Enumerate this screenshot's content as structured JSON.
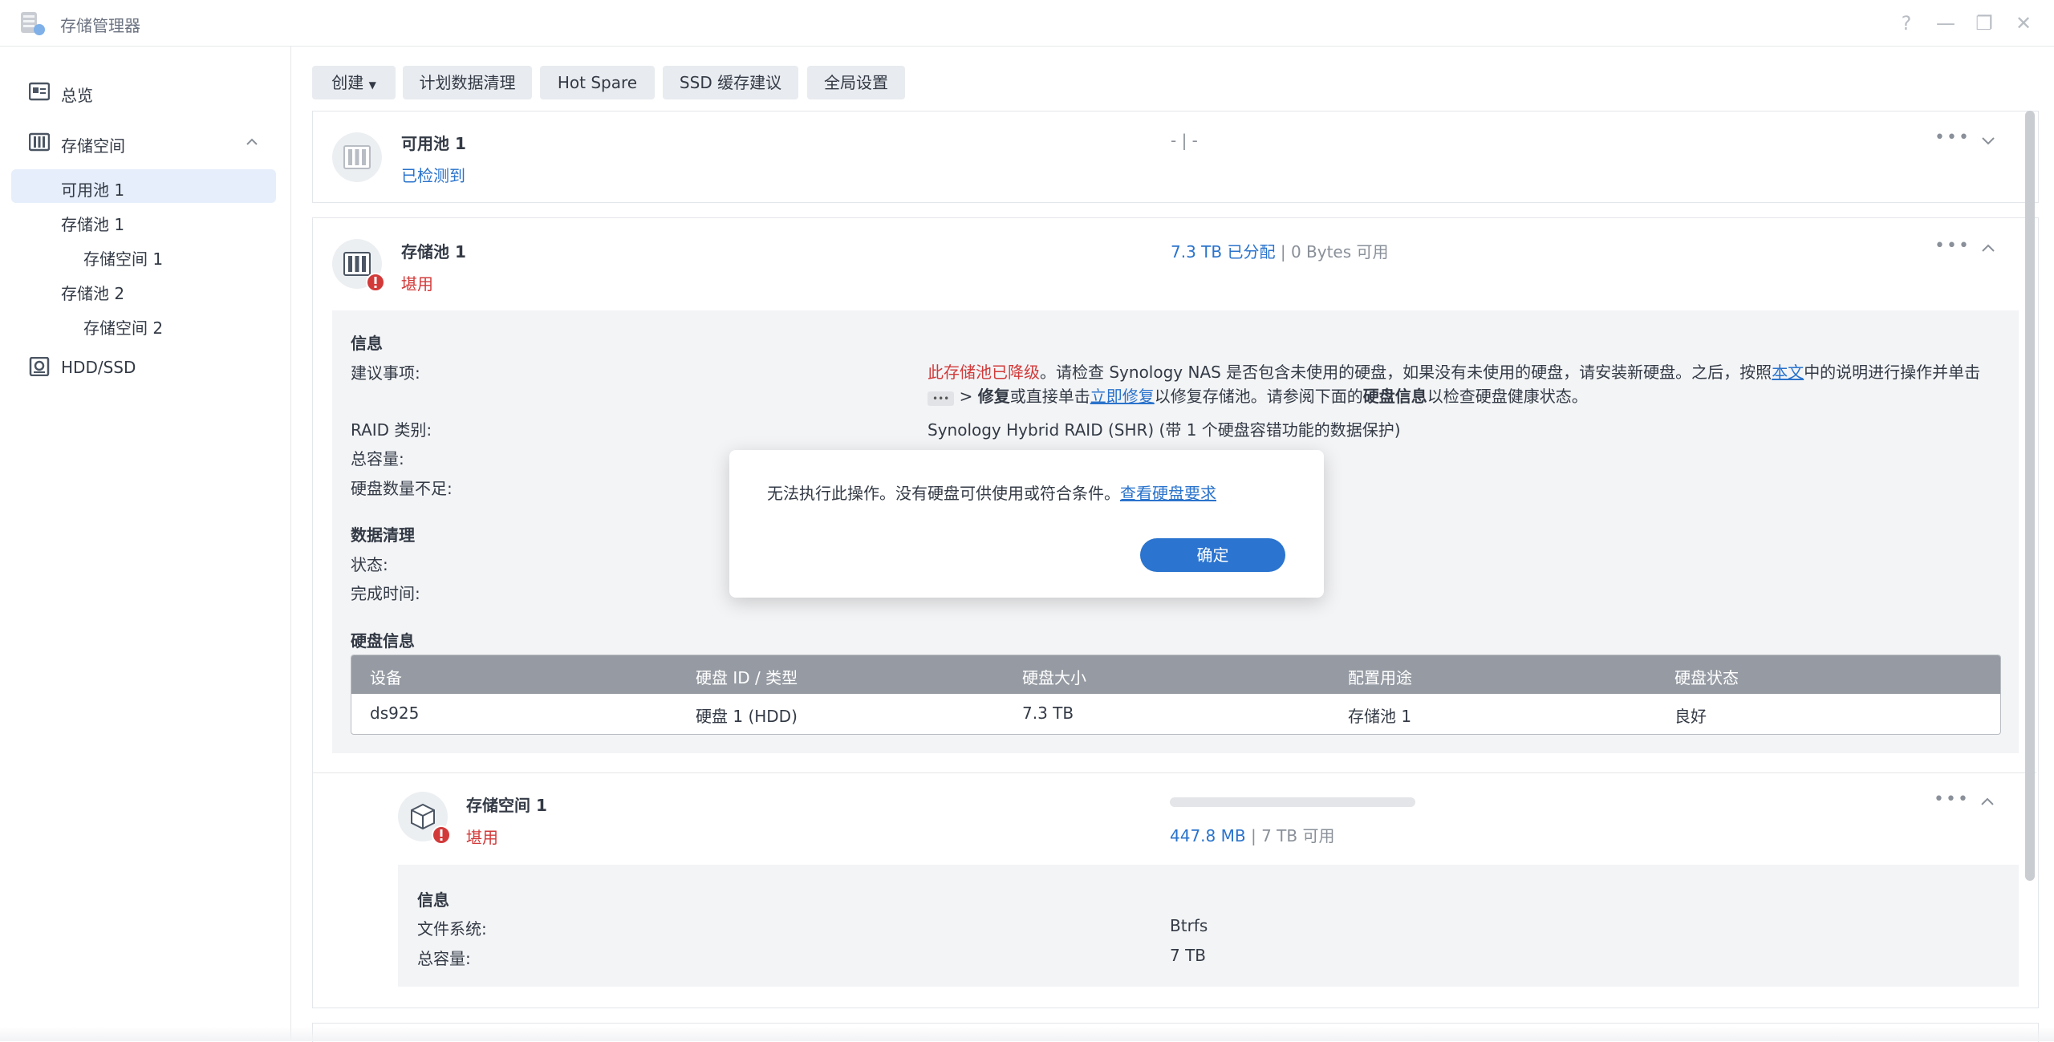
{
  "app": {
    "title": "存储管理器"
  },
  "window_controls": {
    "help": "?",
    "minimize": "—",
    "restore": "❐",
    "close": "✕"
  },
  "sidebar": {
    "items": [
      {
        "label": "总览",
        "icon": "overview-icon"
      },
      {
        "label": "存储空间",
        "icon": "storage-icon"
      },
      {
        "label": "HDD/SSD",
        "icon": "disk-icon"
      }
    ],
    "subitems": [
      {
        "label": "可用池 1"
      },
      {
        "label": "存储池 1"
      },
      {
        "label": "存储空间 1"
      },
      {
        "label": "存储池 2"
      },
      {
        "label": "存储空间 2"
      }
    ]
  },
  "toolbar": {
    "create": "创建",
    "scrub": "计划数据清理",
    "hotspare": "Hot Spare",
    "ssd": "SSD 缓存建议",
    "global": "全局设置"
  },
  "available_pool": {
    "name": "可用池 1",
    "status": "已检测到",
    "meta": "- | -"
  },
  "storage_pool": {
    "name": "存储池 1",
    "status": "堪用",
    "allocated": "7.3 TB 已分配",
    "sep": "|",
    "available": "0 Bytes 可用",
    "info_title": "信息",
    "suggest_label": "建议事项:",
    "suggest_red": "此存储池已降级",
    "suggest_line1": "。请检查 Synology NAS 是否包含未使用的硬盘，如果没有未使用的硬盘，请安装新硬盘。之后，按照",
    "suggest_link1": "本文",
    "suggest_line1b": "中的说明进行操作并单击",
    "suggest_dots": "•••",
    "suggest_line2a": " > ",
    "suggest_bold1": "修复",
    "suggest_line2b": "或直接单击",
    "suggest_link2": "立即修复",
    "suggest_line2c": "以修复存储池。请参阅下面的",
    "suggest_bold2": "硬盘信息",
    "suggest_line2d": "以检查硬盘健康状态。",
    "raid_label": "RAID 类别:",
    "raid_value": "Synology Hybrid RAID (SHR) (带 1 个硬盘容错功能的数据保护)",
    "capacity_label": "总容量:",
    "missing_label": "硬盘数量不足:",
    "scrub_title": "数据清理",
    "state_label": "状态:",
    "done_label": "完成时间:",
    "disk_title": "硬盘信息",
    "table": {
      "headers": [
        "设备",
        "硬盘 ID / 类型",
        "硬盘大小",
        "配置用途",
        "硬盘状态"
      ],
      "rows": [
        [
          "ds925",
          "硬盘 1 (HDD)",
          "7.3 TB",
          "存储池 1",
          "良好"
        ]
      ]
    }
  },
  "volume": {
    "name": "存储空间 1",
    "status": "堪用",
    "used": "447.8 MB",
    "sep": "|",
    "available": "7 TB 可用",
    "usage_fraction": 0.0001,
    "info_title": "信息",
    "fs_label": "文件系统:",
    "fs_value": "Btrfs",
    "cap_label": "总容量:",
    "cap_value": "7 TB"
  },
  "modal": {
    "message": "无法执行此操作。没有硬盘可供使用或符合条件。",
    "link": "查看硬盘要求",
    "ok": "确定"
  }
}
